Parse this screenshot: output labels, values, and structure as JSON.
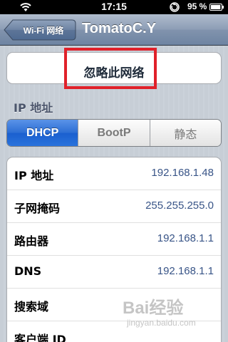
{
  "status_bar": {
    "time": "17:15",
    "battery_percent": "95 %",
    "battery_level": 0.95,
    "icons": [
      "wifi-icon",
      "lock-icon",
      "battery-icon"
    ]
  },
  "nav": {
    "back_label": "Wi-Fi 网络",
    "title": "TomatoC.Y"
  },
  "forget": {
    "label": "忽略此网络"
  },
  "section": {
    "ip_header": "IP 地址"
  },
  "segments": [
    {
      "label": "DHCP",
      "selected": true
    },
    {
      "label": "BootP",
      "selected": false
    },
    {
      "label": "静态",
      "selected": false
    }
  ],
  "rows": [
    {
      "label": "IP 地址",
      "value": "192.168.1.48"
    },
    {
      "label": "子网掩码",
      "value": "255.255.255.0"
    },
    {
      "label": "路由器",
      "value": "192.168.1.1"
    },
    {
      "label": "DNS",
      "value": "192.168.1.1"
    },
    {
      "label": "搜索域",
      "value": ""
    },
    {
      "label": "客户端 ID",
      "value": ""
    }
  ],
  "watermark": {
    "logo": "Bai经验",
    "url": "jingyan.baidu.com"
  },
  "colors": {
    "highlight": "#e0212a",
    "segment_active": "#2c6ed4",
    "value_text": "#385487"
  }
}
